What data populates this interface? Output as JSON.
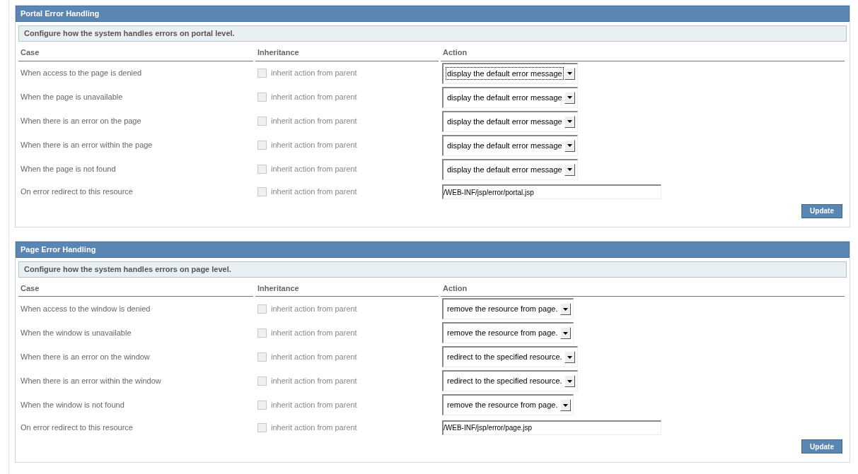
{
  "panels": [
    {
      "title": "Portal Error Handling",
      "description": "Configure how the system handles errors on portal level.",
      "columns": [
        "Case",
        "Inheritance",
        "Action"
      ],
      "rows": [
        {
          "kind": "select",
          "case": "When access to the page is denied",
          "inherit_label": "inherit action from parent",
          "inherit_checked": false,
          "disabled": true,
          "value": "display the default error message",
          "focused": true
        },
        {
          "kind": "select",
          "case": "When the page is unavailable",
          "inherit_label": "inherit action from parent",
          "inherit_checked": false,
          "disabled": true,
          "value": "display the default error message",
          "focused": false
        },
        {
          "kind": "select",
          "case": "When there is an error on the page",
          "inherit_label": "inherit action from parent",
          "inherit_checked": false,
          "disabled": true,
          "value": "display the default error message",
          "focused": false
        },
        {
          "kind": "select",
          "case": "When there is an error within the page",
          "inherit_label": "inherit action from parent",
          "inherit_checked": false,
          "disabled": true,
          "value": "display the default error message",
          "focused": false
        },
        {
          "kind": "select",
          "case": "When the page is not found",
          "inherit_label": "inherit action from parent",
          "inherit_checked": false,
          "disabled": true,
          "value": "display the default error message",
          "focused": false
        },
        {
          "kind": "text",
          "case": "On error redirect to this resource",
          "inherit_label": "inherit action from parent",
          "inherit_checked": false,
          "disabled": true,
          "value": "/WEB-INF/jsp/error/portal.jsp"
        }
      ],
      "button": "Update"
    },
    {
      "title": "Page Error Handling",
      "description": "Configure how the system handles errors on page level.",
      "columns": [
        "Case",
        "Inheritance",
        "Action"
      ],
      "rows": [
        {
          "kind": "select",
          "case": "When access to the window is denied",
          "inherit_label": "inherit action from parent",
          "inherit_checked": false,
          "disabled": true,
          "value": "remove the resource from page.",
          "focused": false
        },
        {
          "kind": "select",
          "case": "When the window is unavailable",
          "inherit_label": "inherit action from parent",
          "inherit_checked": false,
          "disabled": true,
          "value": "remove the resource from page.",
          "focused": false
        },
        {
          "kind": "select",
          "case": "When there is an error on the window",
          "inherit_label": "inherit action from parent",
          "inherit_checked": false,
          "disabled": true,
          "value": "redirect to the specified resource.",
          "focused": false
        },
        {
          "kind": "select",
          "case": "When there is an error within the window",
          "inherit_label": "inherit action from parent",
          "inherit_checked": false,
          "disabled": true,
          "value": "redirect to the specified resource.",
          "focused": false
        },
        {
          "kind": "select",
          "case": "When the window is not found",
          "inherit_label": "inherit action from parent",
          "inherit_checked": false,
          "disabled": true,
          "value": "remove the resource from page.",
          "focused": false
        },
        {
          "kind": "text",
          "case": "On error redirect to this resource",
          "inherit_label": "inherit action from parent",
          "inherit_checked": false,
          "disabled": true,
          "value": "/WEB-INF/jsp/error/page.jsp"
        }
      ],
      "button": "Update"
    }
  ]
}
